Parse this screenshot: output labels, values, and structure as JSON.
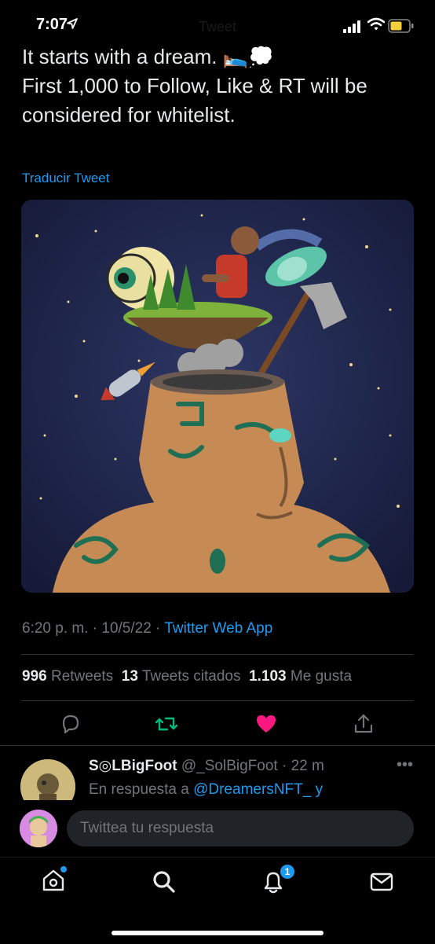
{
  "status_bar": {
    "time": "7:07",
    "title": "Tweet"
  },
  "tweet": {
    "text_line1": "It starts with a dream. 🛌💭",
    "text_line2": "First 1,000 to Follow, Like & RT will be considered for whitelist.",
    "translate_link": "Traducir Tweet",
    "timestamp": "6:20 p. m. · 10/5/22 · ",
    "source": "Twitter Web App",
    "retweets_count": "996",
    "retweets_label": "Retweets",
    "quotes_count": "13",
    "quotes_label": "Tweets citados",
    "likes_count": "1.103",
    "likes_label": "Me gusta"
  },
  "reply": {
    "name": "S◎LBigFoot",
    "handle": "@_SolBigFoot",
    "time": " · 22 m",
    "in_reply_prefix": "En respuesta a ",
    "in_reply_user": "@DreamersNFT_ y"
  },
  "compose": {
    "placeholder": "Twittea tu respuesta"
  },
  "tabbar": {
    "notifications_badge": "1"
  },
  "colors": {
    "accent": "#1d9bf0",
    "retweet_active": "#00ba7c",
    "like_active": "#f91880",
    "background": "#000000"
  },
  "icons": [
    "location-arrow-icon",
    "signal-icon",
    "wifi-icon",
    "battery-icon",
    "reply-icon",
    "retweet-icon",
    "like-icon",
    "share-icon",
    "more-icon",
    "home-icon",
    "search-icon",
    "notifications-icon",
    "messages-icon"
  ]
}
